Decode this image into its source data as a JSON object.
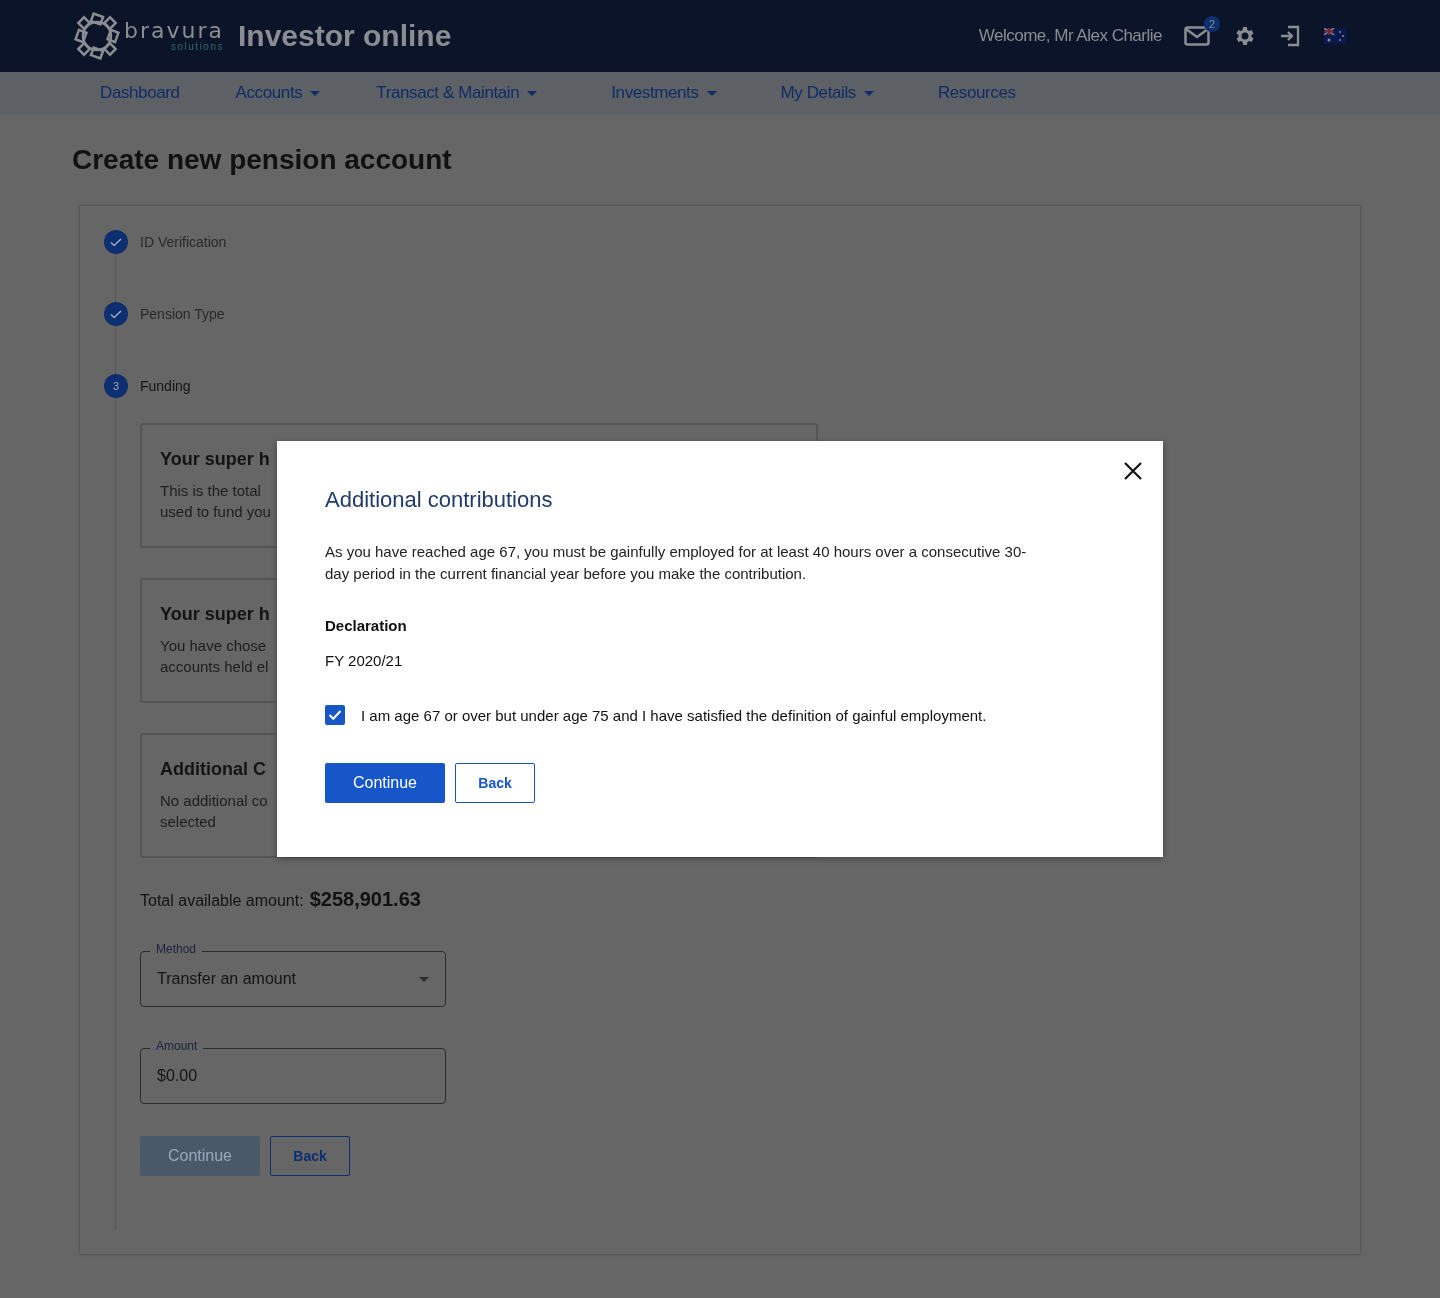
{
  "header": {
    "logo": {
      "brand": "bravura",
      "sub": "solutions"
    },
    "app_title": "Investor online",
    "welcome": "Welcome, Mr Alex Charlie",
    "mail_count": "2"
  },
  "nav": [
    {
      "label": "Dashboard",
      "has_menu": false
    },
    {
      "label": "Accounts",
      "has_menu": true
    },
    {
      "label": "Transact & Maintain",
      "has_menu": true
    },
    {
      "label": "Investments",
      "has_menu": true
    },
    {
      "label": "My Details",
      "has_menu": true
    },
    {
      "label": "Resources",
      "has_menu": false
    }
  ],
  "page_title": "Create new pension account",
  "steps": [
    {
      "label": "ID Verification",
      "kind": "done"
    },
    {
      "label": "Pension Type",
      "kind": "done"
    },
    {
      "label": "Funding",
      "kind": "current",
      "number": "3"
    }
  ],
  "cards": [
    {
      "title": "Your super h",
      "lines": [
        "This is the total",
        "used to fund you"
      ]
    },
    {
      "title": "Your super h",
      "lines": [
        "You have chose",
        "accounts held el"
      ]
    },
    {
      "title": "Additional C",
      "lines": [
        "No additional co",
        "selected"
      ]
    }
  ],
  "total": {
    "label": "Total available amount:",
    "amount": "$258,901.63"
  },
  "fields": [
    {
      "kind": "select",
      "label": "Method",
      "value": "Transfer an amount"
    },
    {
      "kind": "input",
      "label": "Amount",
      "value": "$0.00"
    }
  ],
  "buttons": [
    {
      "label": "Continue",
      "kind": "primary",
      "disabled": true
    },
    {
      "label": "Back",
      "kind": "secondary"
    }
  ],
  "modal": {
    "title": "Additional contributions",
    "body": "As you have reached age 67, you must be gainfully employed for at least 40 hours over a consecutive 30-day period in the current financial year before you make the contribution.",
    "declaration": "Declaration",
    "year": "FY 2020/21",
    "checkbox": {
      "label": "I am age 67 or over but under age 75 and I have satisfied the definition of gainful employment.",
      "checked": true
    },
    "buttons": [
      {
        "label": "Continue",
        "kind": "primary",
        "disabled": false
      },
      {
        "label": "Back",
        "kind": "secondary"
      }
    ]
  }
}
